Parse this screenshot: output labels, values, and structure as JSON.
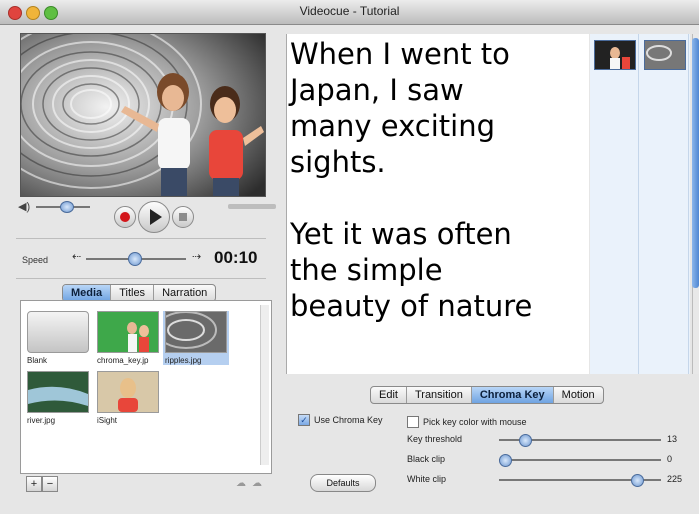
{
  "window": {
    "title": "Videocue - Tutorial"
  },
  "player": {
    "speed_label": "Speed",
    "time": "00:10",
    "volume_level": 0.45,
    "speed_level": 0.45
  },
  "media_tabs": [
    {
      "label": "Media",
      "selected": true
    },
    {
      "label": "Titles",
      "selected": false
    },
    {
      "label": "Narration",
      "selected": false
    }
  ],
  "media_items": [
    {
      "label": "Blank"
    },
    {
      "label": "chroma_key.jp"
    },
    {
      "label": "ripples.jpg",
      "selected": true
    },
    {
      "label": "river.jpg"
    },
    {
      "label": "iSight"
    }
  ],
  "media_buttons": {
    "add": "+",
    "remove": "−"
  },
  "script": {
    "text": "When I went to\nJapan, I saw\nmany exciting\nsights.\n\nYet it was often\nthe simple\nbeauty of nature"
  },
  "edit_tabs": [
    {
      "label": "Edit",
      "selected": false
    },
    {
      "label": "Transition",
      "selected": false
    },
    {
      "label": "Chroma Key",
      "selected": true
    },
    {
      "label": "Motion",
      "selected": false
    }
  ],
  "chroma": {
    "use_chroma_key_label": "Use Chroma Key",
    "use_chroma_key_checked": true,
    "pick_color_label": "Pick key color with mouse",
    "pick_color_checked": false,
    "key_threshold_label": "Key threshold",
    "key_threshold_value": "13",
    "key_threshold_level": 0.13,
    "black_clip_label": "Black clip",
    "black_clip_value": "0",
    "black_clip_level": 0.0,
    "white_clip_label": "White clip",
    "white_clip_value": "225",
    "white_clip_level": 0.88,
    "defaults_label": "Defaults"
  },
  "colors": {
    "accent": "#6fa3e2",
    "selection": "#b5cff0"
  }
}
